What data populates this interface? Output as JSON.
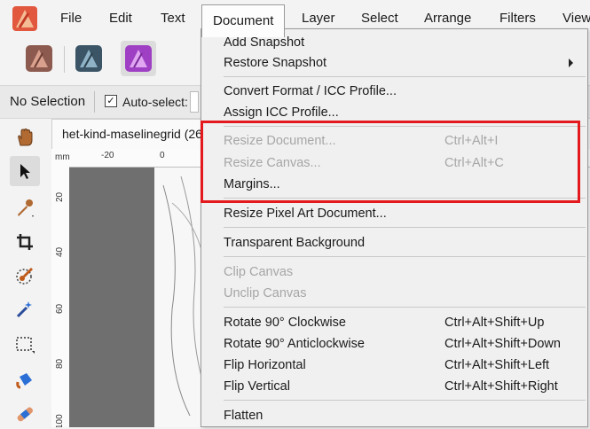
{
  "menubar": {
    "items": [
      {
        "label": "File"
      },
      {
        "label": "Edit"
      },
      {
        "label": "Text"
      },
      {
        "label": "Document"
      },
      {
        "label": "Layer"
      },
      {
        "label": "Select"
      },
      {
        "label": "Arrange"
      },
      {
        "label": "Filters"
      },
      {
        "label": "View"
      }
    ],
    "active": "Document"
  },
  "personas": [
    "designer-persona-icon",
    "publisher-persona-icon",
    "photo-persona-icon"
  ],
  "context_bar": {
    "selection_label": "No Selection",
    "auto_select_label": "Auto-select:",
    "auto_select_checked": true
  },
  "document_tab": {
    "title": "het-kind-maselinegrid (26"
  },
  "rulers": {
    "unit": "mm",
    "top_ticks": [
      "-20",
      "0"
    ],
    "left_ticks": [
      "20",
      "40",
      "60",
      "80",
      "100"
    ]
  },
  "document_menu": {
    "items": [
      {
        "label": "Add Snapshot",
        "shortcut": "",
        "disabled": false
      },
      {
        "label": "Restore Snapshot",
        "shortcut": "",
        "disabled": false,
        "submenu": true
      },
      {
        "label": "Convert Format / ICC Profile...",
        "shortcut": "",
        "disabled": false
      },
      {
        "label": "Assign ICC Profile...",
        "shortcut": "",
        "disabled": false
      },
      {
        "label": "Resize Document...",
        "shortcut": "Ctrl+Alt+I",
        "disabled": true
      },
      {
        "label": "Resize Canvas...",
        "shortcut": "Ctrl+Alt+C",
        "disabled": true
      },
      {
        "label": "Margins...",
        "shortcut": "",
        "disabled": false
      },
      {
        "label": "Resize Pixel Art Document...",
        "shortcut": "",
        "disabled": false
      },
      {
        "label": "Transparent Background",
        "shortcut": "",
        "disabled": false
      },
      {
        "label": "Clip Canvas",
        "shortcut": "",
        "disabled": true
      },
      {
        "label": "Unclip Canvas",
        "shortcut": "",
        "disabled": true
      },
      {
        "label": "Rotate 90° Clockwise",
        "shortcut": "Ctrl+Alt+Shift+Up",
        "disabled": false
      },
      {
        "label": "Rotate 90° Anticlockwise",
        "shortcut": "Ctrl+Alt+Shift+Down",
        "disabled": false
      },
      {
        "label": "Flip Horizontal",
        "shortcut": "Ctrl+Alt+Shift+Left",
        "disabled": false
      },
      {
        "label": "Flip Vertical",
        "shortcut": "Ctrl+Alt+Shift+Right",
        "disabled": false
      },
      {
        "label": "Flatten",
        "shortcut": "",
        "disabled": false
      }
    ]
  },
  "colors": {
    "highlight": "#e3191d",
    "disabled_text": "#a6a6a6"
  },
  "tools": [
    "hand-icon",
    "move-icon",
    "color-picker-icon",
    "crop-icon",
    "paint-brush-icon",
    "magic-wand-icon",
    "marquee-selection-icon",
    "flood-fill-icon",
    "healing-brush-icon"
  ]
}
